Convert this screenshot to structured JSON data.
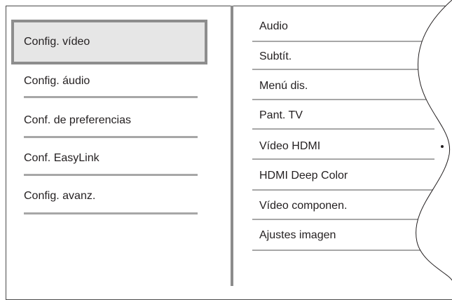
{
  "left_menu": {
    "items": [
      {
        "label": "Config. vídeo",
        "selected": true
      },
      {
        "label": "Config. áudio",
        "selected": false
      },
      {
        "label": "Conf. de preferencias",
        "selected": false
      },
      {
        "label": "Conf. EasyLink",
        "selected": false
      },
      {
        "label": "Config. avanz.",
        "selected": false
      }
    ]
  },
  "submenu": {
    "items": [
      {
        "label": "Audio"
      },
      {
        "label": "Subtít."
      },
      {
        "label": "Menú dis."
      },
      {
        "label": "Pant. TV"
      },
      {
        "label": "Vídeo HDMI",
        "has_indicator": true
      },
      {
        "label": "HDMI Deep Color",
        "has_indicator": true
      },
      {
        "label": "Vídeo componen."
      },
      {
        "label": "Ajustes imagen"
      }
    ]
  },
  "colors": {
    "selected_background": "#e6e6e6",
    "selected_border": "#8d8d8d",
    "separator": "#a7a7a7",
    "text": "#231f20"
  }
}
